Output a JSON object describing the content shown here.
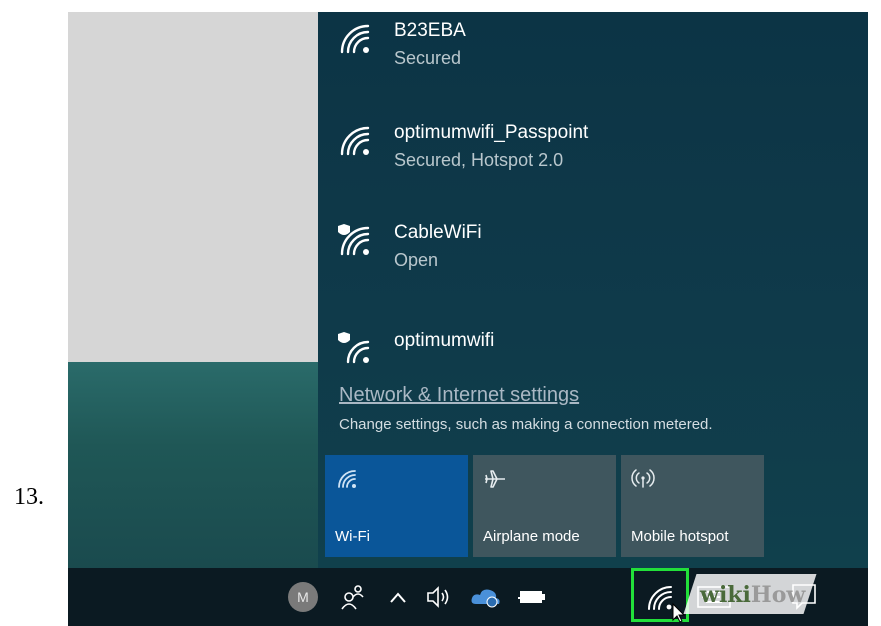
{
  "step_number": "13.",
  "networks": [
    {
      "name": "B23EBA",
      "status": "Secured",
      "shield": false
    },
    {
      "name": "optimumwifi_Passpoint",
      "status": "Secured, Hotspot 2.0",
      "shield": false
    },
    {
      "name": "CableWiFi",
      "status": "Open",
      "shield": true
    },
    {
      "name": "optimumwifi",
      "status": "",
      "shield": true
    }
  ],
  "settings": {
    "link": "Network & Internet settings",
    "description": "Change settings, such as making a connection metered."
  },
  "quick_actions": [
    {
      "label": "Wi-Fi",
      "icon": "wifi-icon",
      "active": true
    },
    {
      "label": "Airplane mode",
      "icon": "airplane-icon",
      "active": false
    },
    {
      "label": "Mobile hotspot",
      "icon": "hotspot-icon",
      "active": false
    }
  ],
  "taskbar": {
    "avatar_letter": "M",
    "icons": [
      "people-icon",
      "chevron-up-icon",
      "volume-icon",
      "onedrive-icon",
      "battery-icon",
      "wifi-icon",
      "keyboard-icon",
      "action-center-icon"
    ]
  },
  "watermark": {
    "part1": "wiki",
    "part2": "How"
  },
  "colors": {
    "active_tile": "#0a5699",
    "highlight_box": "#22e03a"
  }
}
